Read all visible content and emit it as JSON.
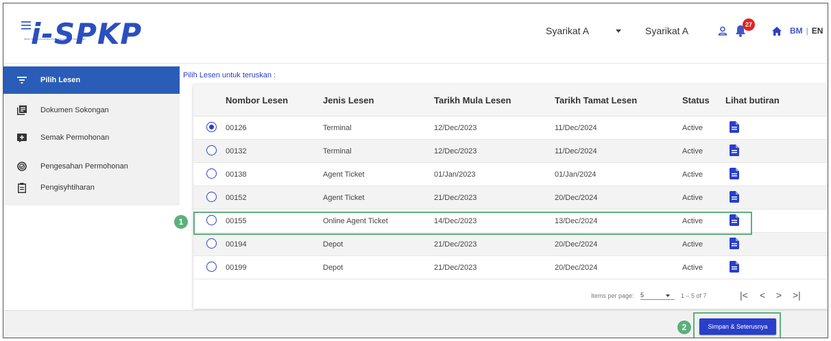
{
  "header": {
    "logo_text": "i-SPKP",
    "logo_subtitle": "Sistem Integrasi Permohonan Perlesenan Kenderaan Perdagangan",
    "company_select": "Syarikat A",
    "company_name": "Syarikat A",
    "notification_count": "27",
    "lang_bm": "BM",
    "lang_sep": "|",
    "lang_en": "EN"
  },
  "sidebar": {
    "items": [
      {
        "label": "Pilih Lesen",
        "icon": "filter-list-icon",
        "active": true
      },
      {
        "label": "Dokumen Sokongan",
        "icon": "documents-icon",
        "active": false
      },
      {
        "label": "Semak Permohonan",
        "icon": "add-box-icon",
        "active": false
      },
      {
        "label": "Pengesahan Permohonan",
        "icon": "check-circle-icon",
        "active": false
      },
      {
        "label": "Pengisyhtiharan",
        "icon": "clipboard-icon",
        "active": false
      }
    ]
  },
  "main": {
    "title": "Pilih Lesen untuk teruskan :",
    "columns": [
      "Nombor Lesen",
      "Jenis Lesen",
      "Tarikh Mula Lesen",
      "Tarikh Tamat Lesen",
      "Status",
      "Lihat butiran"
    ],
    "rows": [
      {
        "no": "00126",
        "jenis": "Terminal",
        "mula": "12/Dec/2023",
        "tamat": "11/Dec/2024",
        "status": "Active",
        "selected": true
      },
      {
        "no": "00132",
        "jenis": "Terminal",
        "mula": "12/Dec/2023",
        "tamat": "11/Dec/2024",
        "status": "Active",
        "selected": false
      },
      {
        "no": "00138",
        "jenis": "Agent Ticket",
        "mula": "01/Jan/2023",
        "tamat": "01/Jan/2024",
        "status": "Active",
        "selected": false
      },
      {
        "no": "00152",
        "jenis": "Agent Ticket",
        "mula": "21/Dec/2023",
        "tamat": "20/Dec/2024",
        "status": "Active",
        "selected": false
      },
      {
        "no": "00155",
        "jenis": "Online Agent Ticket",
        "mula": "14/Dec/2023",
        "tamat": "13/Dec/2024",
        "status": "Active",
        "selected": false
      },
      {
        "no": "00194",
        "jenis": "Depot",
        "mula": "21/Dec/2023",
        "tamat": "20/Dec/2024",
        "status": "Active",
        "selected": false
      },
      {
        "no": "00199",
        "jenis": "Depot",
        "mula": "21/Dec/2023",
        "tamat": "20/Dec/2024",
        "status": "Active",
        "selected": false
      }
    ],
    "paginator": {
      "items_label": "Items per page:",
      "items_value": "5",
      "range": "1 – 5 of 7",
      "first": "|<",
      "prev": "<",
      "next": ">",
      "last": ">|"
    }
  },
  "annotations": {
    "step1": "1",
    "step2": "2"
  },
  "footer": {
    "primary_button": "Simpan & Seterusnya"
  },
  "colors": {
    "primary": "#2a3fc9",
    "sidebar_active": "#2a5db8",
    "annotation": "#5bb07a",
    "badge": "#e02424"
  }
}
